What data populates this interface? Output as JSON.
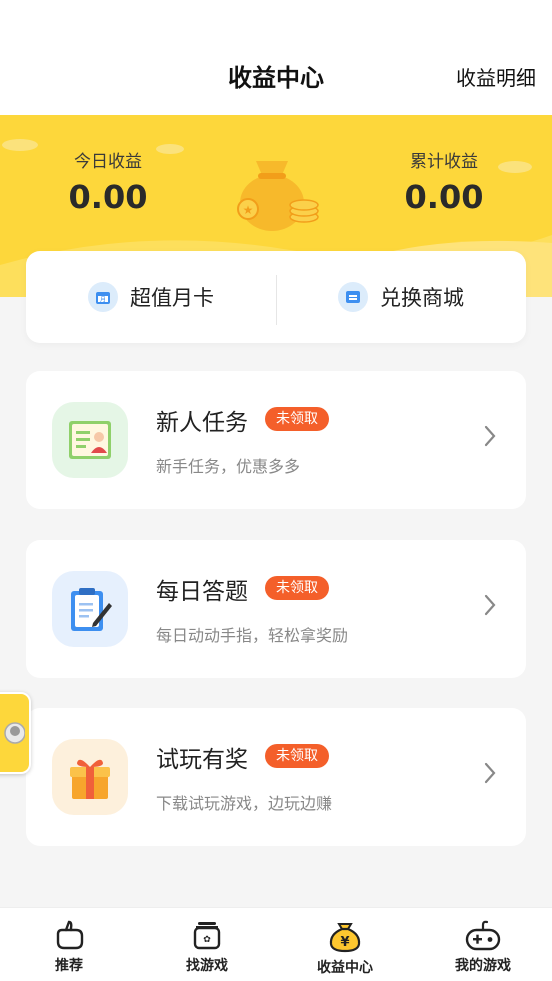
{
  "header": {
    "title": "收益中心",
    "detail_link": "收益明细"
  },
  "earnings": {
    "today_label": "今日收益",
    "today_value": "0.00",
    "total_label": "累计收益",
    "total_value": "0.00"
  },
  "quick_actions": [
    {
      "label": "超值月卡",
      "icon": "calendar-icon"
    },
    {
      "label": "兑换商城",
      "icon": "shop-icon"
    }
  ],
  "tasks": [
    {
      "title": "新人任务",
      "badge": "未领取",
      "subtitle": "新手任务，优惠多多",
      "icon": "id-card-icon",
      "icon_bg": "#e5f6e6"
    },
    {
      "title": "每日答题",
      "badge": "未领取",
      "subtitle": "每日动动手指，轻松拿奖励",
      "icon": "clipboard-icon",
      "icon_bg": "#e6f0fd"
    },
    {
      "title": "试玩有奖",
      "badge": "未领取",
      "subtitle": "下载试玩游戏，边玩边赚",
      "icon": "gift-icon",
      "icon_bg": "#fdf0dc"
    }
  ],
  "tabbar": {
    "items": [
      {
        "label": "推荐",
        "icon": "recommend-icon"
      },
      {
        "label": "找游戏",
        "icon": "find-game-icon"
      },
      {
        "label": "收益中心",
        "icon": "money-bag-icon",
        "active": true
      },
      {
        "label": "我的游戏",
        "icon": "gamepad-icon"
      }
    ]
  },
  "colors": {
    "brand_yellow": "#fdd73b",
    "badge_orange": "#f45f2a"
  }
}
